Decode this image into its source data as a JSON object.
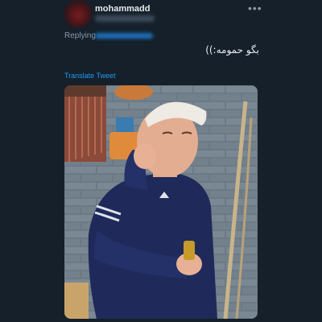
{
  "tweet": {
    "display_name": "mohammadd",
    "more_icon": "•••",
    "replying_label": "Replying",
    "text": "بگو حمومه:))",
    "translate_label": "Translate Tweet"
  },
  "colors": {
    "background": "#15202b",
    "link": "#1d9bf0",
    "secondary_text": "#8b98a5",
    "primary_text": "#e7e9ea"
  },
  "media": {
    "icons": [
      "avatar",
      "more-icon"
    ]
  }
}
